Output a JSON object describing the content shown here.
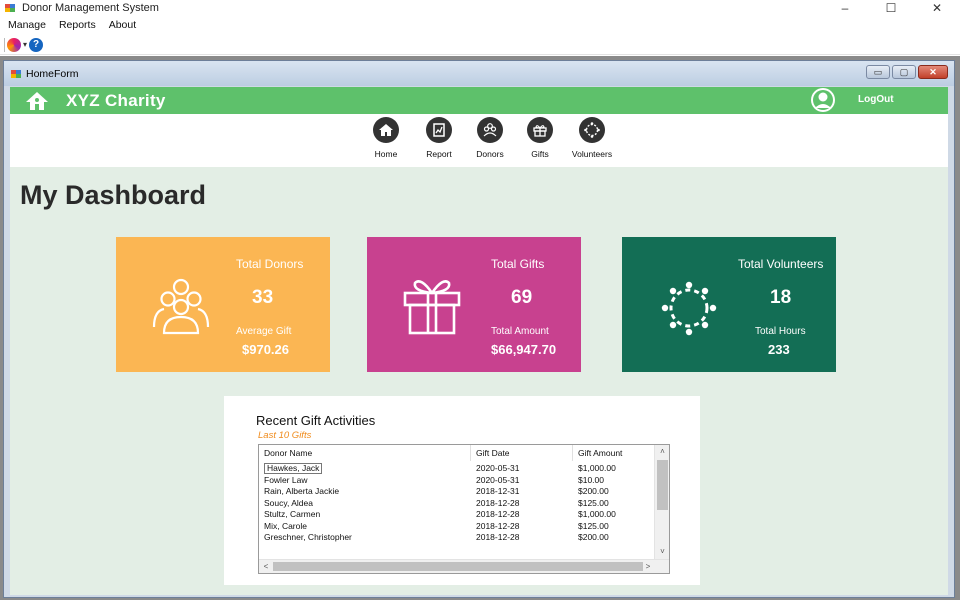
{
  "window": {
    "title": "Donor Management System",
    "controls": {
      "minimize": "–",
      "maximize": "☐",
      "close": "✕"
    }
  },
  "menu": [
    "Manage",
    "Reports",
    "About"
  ],
  "toolbar": {
    "icons": [
      "color-wheel-icon",
      "help-icon"
    ],
    "help_glyph": "?"
  },
  "child_window": {
    "title": "HomeForm",
    "controls": {
      "minimize": "▭",
      "maximize": "▢",
      "close": "✕"
    }
  },
  "header": {
    "org_name": "XYZ Charity",
    "logout_label": "LogOut",
    "bar_color": "#5ec16b"
  },
  "nav": [
    {
      "label": "Home",
      "icon": "home-icon"
    },
    {
      "label": "Report",
      "icon": "report-icon"
    },
    {
      "label": "Donors",
      "icon": "donors-icon"
    },
    {
      "label": "Gifts",
      "icon": "gift-icon"
    },
    {
      "label": "Volunteers",
      "icon": "volunteers-icon"
    }
  ],
  "dashboard_title": "My Dashboard",
  "cards": [
    {
      "title": "Total Donors",
      "value": "33",
      "sub_label": "Average Gift",
      "sub_value": "$970.26",
      "color": "#fbb653",
      "icon": "people-icon"
    },
    {
      "title": "Total Gifts",
      "value": "69",
      "sub_label": "Total Amount",
      "sub_value": "$66,947.70",
      "color": "#c8418f",
      "icon": "gift-icon"
    },
    {
      "title": "Total Volunteers",
      "value": "18",
      "sub_label": "Total Hours",
      "sub_value": "233",
      "color": "#136e55",
      "icon": "volunteers-circle-icon"
    }
  ],
  "recent": {
    "title": "Recent Gift Activities",
    "subtitle": "Last 10 Gifts",
    "columns": [
      "Donor Name",
      "Gift Date",
      "Gift Amount"
    ],
    "rows": [
      [
        "Hawkes, Jack",
        "2020-05-31",
        "$1,000.00"
      ],
      [
        "Fowler Law",
        "2020-05-31",
        "$10.00"
      ],
      [
        "Rain, Alberta Jackie",
        "2018-12-31",
        "$200.00"
      ],
      [
        "Soucy, Aldea",
        "2018-12-28",
        "$125.00"
      ],
      [
        "Stultz, Carmen",
        "2018-12-28",
        "$1,000.00"
      ],
      [
        "Mix, Carole",
        "2018-12-28",
        "$125.00"
      ],
      [
        "Greschner, Christopher",
        "2018-12-28",
        "$200.00"
      ]
    ],
    "scrollbar_arrows": {
      "up": "˄",
      "down": "˅",
      "left": "<",
      "right": ">"
    }
  }
}
